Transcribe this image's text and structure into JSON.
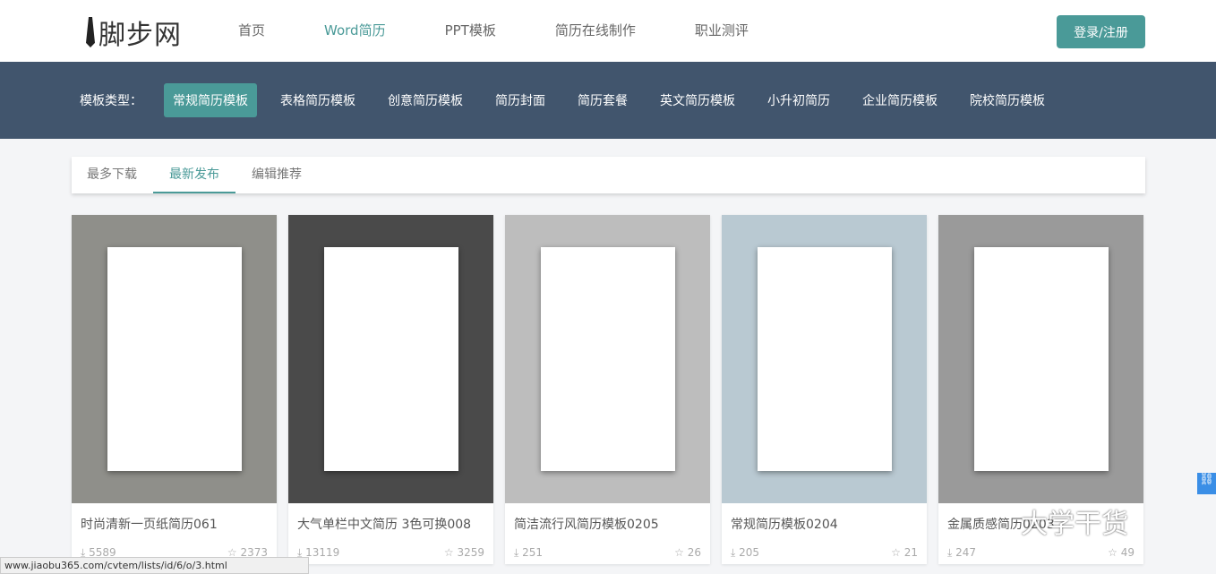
{
  "header": {
    "logo": "脚步网",
    "nav": [
      "首页",
      "Word简历",
      "PPT模板",
      "简历在线制作",
      "职业测评"
    ],
    "active_nav": 1,
    "login": "登录/注册"
  },
  "categories": {
    "label": "模板类型：",
    "items": [
      "常规简历模板",
      "表格简历模板",
      "创意简历模板",
      "简历封面",
      "简历套餐",
      "英文简历模板",
      "小升初简历",
      "企业简历模板",
      "院校简历模板"
    ]
  },
  "sort_tabs": [
    "最多下载",
    "最新发布",
    "编辑推荐"
  ],
  "cards": [
    {
      "title": "时尚清新一页纸简历061",
      "downloads": "5589",
      "favorites": "2373",
      "bg": "#8f8f8a"
    },
    {
      "title": "大气单栏中文简历 3色可换008",
      "downloads": "13119",
      "favorites": "3259",
      "bg": "#4a4a4a"
    },
    {
      "title": "简洁流行风简历模板0205",
      "downloads": "251",
      "favorites": "26",
      "bg": "#bdbdbd"
    },
    {
      "title": "常规简历模板0204",
      "downloads": "205",
      "favorites": "21",
      "bg": "#b9c9d2"
    },
    {
      "title": "金属质感简历0203",
      "downloads": "247",
      "favorites": "49",
      "bg": "#9a9a9a"
    }
  ],
  "status_url": "www.jiaobu365.com/cvtem/lists/id/6/o/3.html",
  "watermark": "大学干货"
}
